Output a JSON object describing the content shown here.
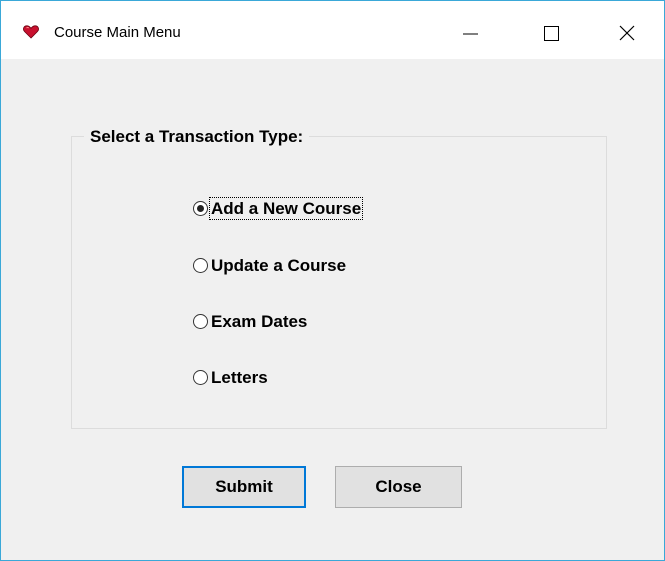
{
  "window": {
    "title": "Course Main Menu",
    "icon": "heart-icon",
    "accent_color": "#0078d7",
    "controls": {
      "minimize": "minimize-icon",
      "maximize": "maximize-icon",
      "close": "close-icon"
    }
  },
  "group": {
    "legend": "Select a Transaction Type:",
    "options": [
      {
        "label": "Add a New Course",
        "selected": true
      },
      {
        "label": "Update a Course",
        "selected": false
      },
      {
        "label": "Exam Dates",
        "selected": false
      },
      {
        "label": "Letters",
        "selected": false
      }
    ]
  },
  "buttons": {
    "submit_label": "Submit",
    "close_label": "Close"
  }
}
